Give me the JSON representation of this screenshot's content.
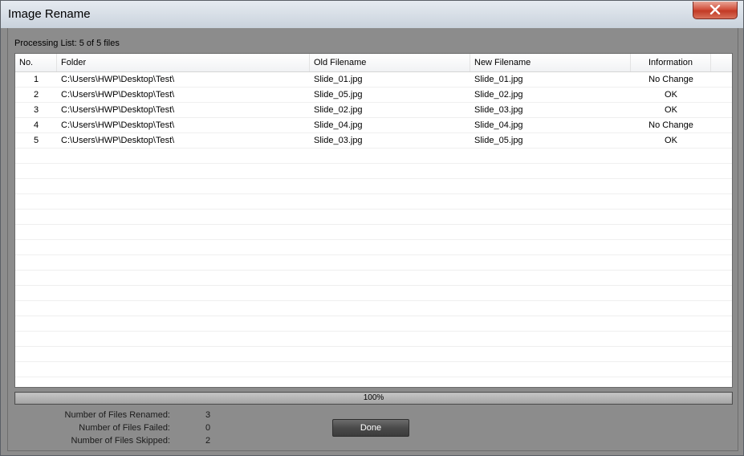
{
  "window": {
    "title": "Image Rename"
  },
  "processing_label": "Processing List: 5 of 5 files",
  "table": {
    "columns": [
      "No.",
      "Folder",
      "Old Filename",
      "New Filename",
      "Information"
    ],
    "rows": [
      [
        "1",
        "C:\\Users\\HWP\\Desktop\\Test\\",
        "Slide_01.jpg",
        "Slide_01.jpg",
        "No Change"
      ],
      [
        "2",
        "C:\\Users\\HWP\\Desktop\\Test\\",
        "Slide_05.jpg",
        "Slide_02.jpg",
        "OK"
      ],
      [
        "3",
        "C:\\Users\\HWP\\Desktop\\Test\\",
        "Slide_02.jpg",
        "Slide_03.jpg",
        "OK"
      ],
      [
        "4",
        "C:\\Users\\HWP\\Desktop\\Test\\",
        "Slide_04.jpg",
        "Slide_04.jpg",
        "No Change"
      ],
      [
        "5",
        "C:\\Users\\HWP\\Desktop\\Test\\",
        "Slide_03.jpg",
        "Slide_05.jpg",
        "OK"
      ]
    ],
    "empty_row_count": 15
  },
  "progress": {
    "text": "100%",
    "value": 1.0
  },
  "stats": [
    {
      "label": "Number of Files Renamed:",
      "value": "3"
    },
    {
      "label": "Number of Files Failed:",
      "value": "0"
    },
    {
      "label": "Number of Files Skipped:",
      "value": "2"
    }
  ],
  "buttons": {
    "done_label": "Done"
  },
  "colors": {
    "dialog_body": "#8c8c8c",
    "close_button": "#c23a25",
    "done_button": "#4a4a4a"
  }
}
